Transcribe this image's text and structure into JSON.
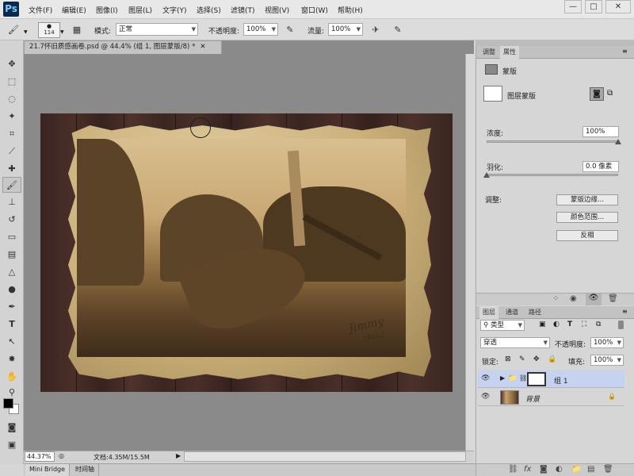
{
  "app": {
    "logo": "Ps",
    "window_controls": [
      "—",
      "□",
      "✕"
    ]
  },
  "menu": [
    "文件(F)",
    "编辑(E)",
    "图像(I)",
    "图层(L)",
    "文字(Y)",
    "选择(S)",
    "滤镜(T)",
    "视图(V)",
    "窗口(W)",
    "帮助(H)"
  ],
  "options": {
    "brush_size": "114",
    "mode_label": "模式:",
    "mode_value": "正常",
    "opacity_label": "不透明度:",
    "opacity_value": "100%",
    "flow_label": "流量:",
    "flow_value": "100%"
  },
  "document": {
    "tab_title": "21.7怀旧质感画卷.psd @ 44.4% (组 1, 图层蒙版/8) *",
    "zoom": "44.37%",
    "doc_info": "文档:4.35M/15.5M",
    "watermark_main": "Jimmy",
    "watermark_sub": "1951.2"
  },
  "bottom_tabs": [
    "Mini Bridge",
    "时间轴"
  ],
  "properties_panel": {
    "tabs": [
      "调整",
      "属性"
    ],
    "section_title": "蒙版",
    "mask_type": "图层蒙版",
    "density_label": "浓度:",
    "density_value": "100%",
    "density_level": 1.0,
    "feather_label": "羽化:",
    "feather_value": "0.0 像素",
    "feather_level": 0.0,
    "refine_label": "调整:",
    "btn_edge": "蒙版边缘...",
    "btn_color_range": "颜色范围...",
    "btn_invert": "反相"
  },
  "layers_panel": {
    "tabs": [
      "图层",
      "通道",
      "路径"
    ],
    "filter_kind": "类型",
    "blend_mode": "穿透",
    "opacity_label": "不透明度:",
    "opacity_value": "100%",
    "lock_label": "锁定:",
    "fill_label": "填充:",
    "fill_value": "100%",
    "layers": [
      {
        "name": "组 1",
        "selected": true
      },
      {
        "name": "背景",
        "selected": false
      }
    ]
  },
  "colors": {
    "selection": "#c5d3f0",
    "foreground": "#000000",
    "background": "#ffffff"
  }
}
